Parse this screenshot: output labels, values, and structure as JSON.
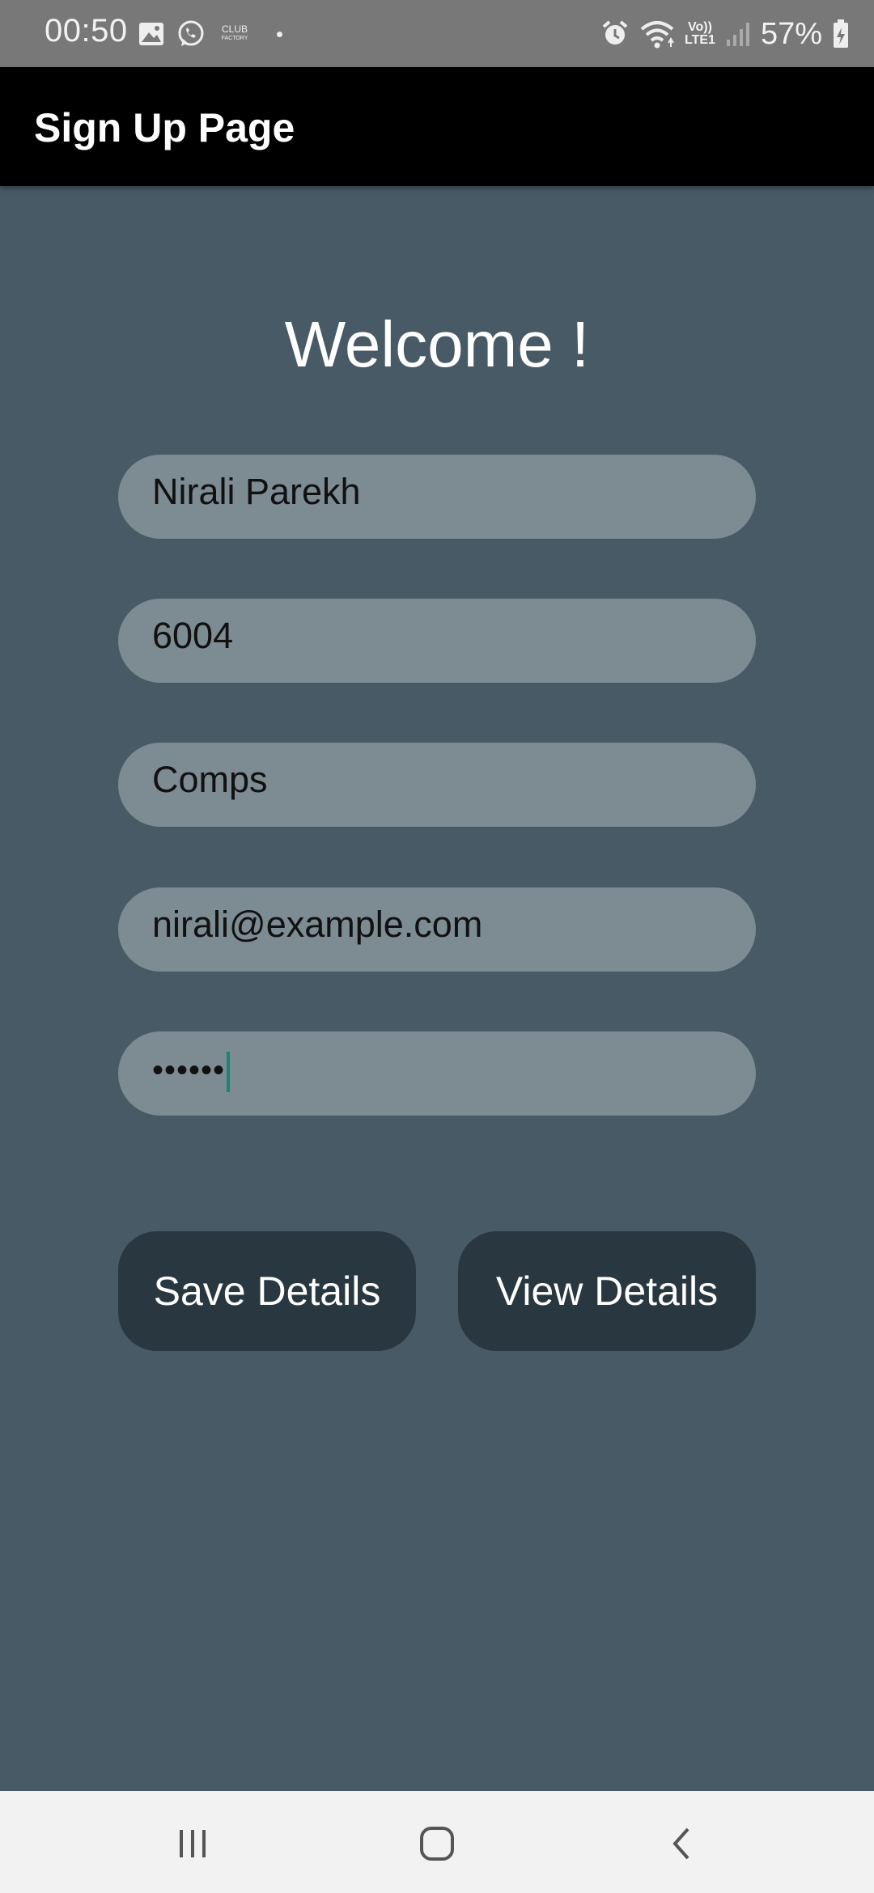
{
  "status_bar": {
    "time": "00:50",
    "club_label": "CLUB",
    "club_sub": "FACTORY",
    "network_top": "Vo))",
    "network_bottom": "LTE1",
    "battery": "57%"
  },
  "app_bar": {
    "title": "Sign Up Page"
  },
  "form": {
    "welcome": "Welcome !",
    "name_value": "Nirali Parekh",
    "id_value": "6004",
    "branch_value": "Comps",
    "email_value": "nirali@example.com",
    "password_masked": "••••••",
    "save_label": "Save Details",
    "view_label": "View Details"
  },
  "nav_bar": {
    "recents": "recents-icon",
    "home": "home-icon",
    "back": "back-icon"
  },
  "colors": {
    "background": "#475a66",
    "field": "#7d8b92",
    "button": "#293840",
    "caret": "#16857a"
  }
}
